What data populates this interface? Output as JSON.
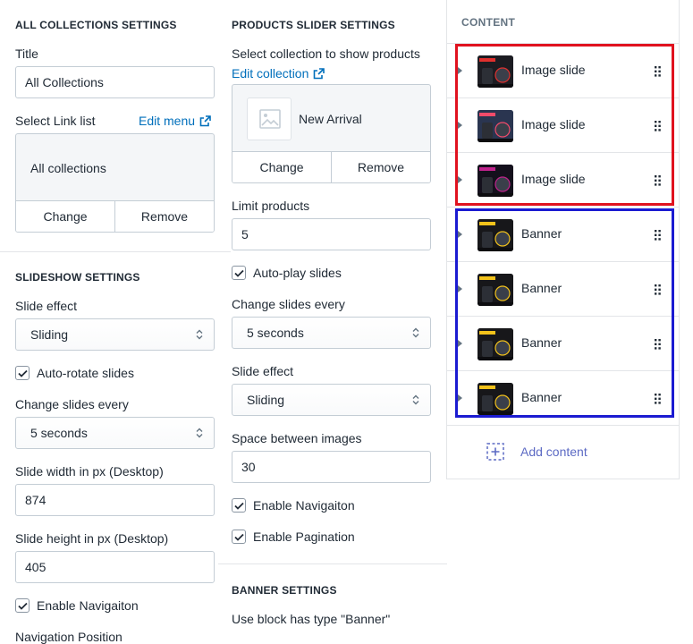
{
  "all_collections": {
    "heading": "ALL COLLECTIONS SETTINGS",
    "title_label": "Title",
    "title_value": "All Collections",
    "link_list_label": "Select Link list",
    "edit_menu_label": "Edit menu",
    "link_list_value": "All collections",
    "change_label": "Change",
    "remove_label": "Remove"
  },
  "slideshow": {
    "heading": "SLIDESHOW SETTINGS",
    "slide_effect_label": "Slide effect",
    "slide_effect_value": "Sliding",
    "auto_rotate_label": "Auto-rotate slides",
    "auto_rotate_checked": true,
    "change_every_label": "Change slides every",
    "change_every_value": "5 seconds",
    "width_label": "Slide width in px (Desktop)",
    "width_value": "874",
    "height_label": "Slide height in px (Desktop)",
    "height_value": "405",
    "enable_nav_label": "Enable Navigaiton",
    "enable_nav_checked": true,
    "nav_position_label": "Navigation Position"
  },
  "products_slider": {
    "heading": "PRODUCTS SLIDER SETTINGS",
    "select_collection_label": "Select collection to show products",
    "edit_collection_label": "Edit collection",
    "collection_name": "New Arrival",
    "change_label": "Change",
    "remove_label": "Remove",
    "limit_label": "Limit products",
    "limit_value": "5",
    "autoplay_label": "Auto-play slides",
    "autoplay_checked": true,
    "change_every_label": "Change slides every",
    "change_every_value": "5 seconds",
    "slide_effect_label": "Slide effect",
    "slide_effect_value": "Sliding",
    "space_label": "Space between images",
    "space_value": "30",
    "enable_nav_label": "Enable Navigaiton",
    "enable_nav_checked": true,
    "enable_pagination_label": "Enable Pagination",
    "enable_pagination_checked": true
  },
  "banner_settings": {
    "heading": "BANNER SETTINGS",
    "description": "Use block has type \"Banner\""
  },
  "content": {
    "heading": "CONTENT",
    "blocks": [
      {
        "label": "Image slide",
        "thumb": "GET OUT",
        "thumb_bg": "#1c1c22",
        "accent": "#e0302e"
      },
      {
        "label": "Image slide",
        "thumb": "SAVE $500",
        "thumb_bg": "#2a3550",
        "accent": "#f24b6a"
      },
      {
        "label": "Image slide",
        "thumb": "NEW",
        "thumb_bg": "#14101c",
        "accent": "#c0228c"
      },
      {
        "label": "Banner",
        "thumb": "EXCLUSIVE BRANDS",
        "thumb_bg": "#17171a",
        "accent": "#f2c21b"
      },
      {
        "label": "Banner",
        "thumb": "BUY 1 GET 1 FREE",
        "thumb_bg": "#17171a",
        "accent": "#f2c21b"
      },
      {
        "label": "Banner",
        "thumb": "SALE 81% OVER 99",
        "thumb_bg": "#17171a",
        "accent": "#f2c21b"
      },
      {
        "label": "Banner",
        "thumb": "APP EXCLUSIVE",
        "thumb_bg": "#17171a",
        "accent": "#f2c21b"
      }
    ],
    "add_content_label": "Add content"
  },
  "colors": {
    "link": "#006fbb",
    "highlight_red": "#e0121f",
    "highlight_blue": "#1b1bd1",
    "add_content": "#5c6ac4"
  }
}
